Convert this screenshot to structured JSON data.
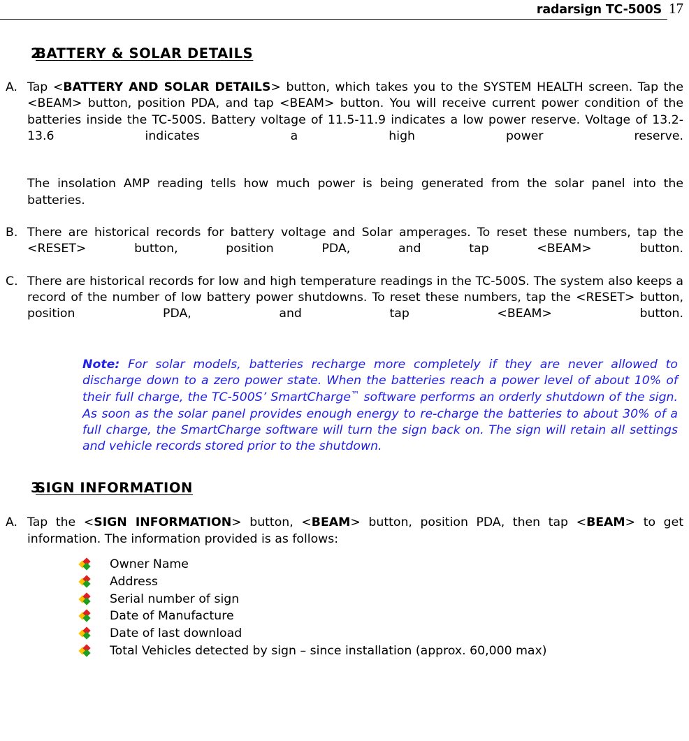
{
  "header": {
    "title": "radarsign TC-500S",
    "page_number": "17"
  },
  "sections": [
    {
      "number": "2.",
      "title": "BATTERY & SOLAR DETAILS",
      "items": [
        {
          "marker": "A.",
          "p1_pre": "Tap ",
          "p1_lt": "<",
          "p1_bold": "BATTERY AND SOLAR DETAILS",
          "p1_gt": ">",
          "p1_post": " button, which takes you to the SYSTEM HEALTH screen.  Tap the <BEAM> button, position PDA, and tap <BEAM> button.  You will receive current power condition of the batteries inside the TC-500S.  Battery voltage of 11.5-11.9 indicates a low power reserve.  Voltage of 13.2-13.6 indicates a high power reserve.",
          "p2": "The insolation AMP reading tells how much power is being generated from the solar panel into the batteries."
        },
        {
          "marker": "B.",
          "text": "There are historical records for battery voltage and Solar amperages.  To reset these numbers, tap the <RESET> button, position PDA, and tap <BEAM> button."
        },
        {
          "marker": "C.",
          "text": "There are historical records for low and high temperature readings in the TC-500S.  The system also keeps a record of the number of low battery power shutdowns.  To reset these numbers, tap the <RESET> button, position PDA, and tap <BEAM> button."
        }
      ],
      "note": {
        "label": "Note:",
        "text_part1": "  For solar models, batteries recharge more completely if they are never allowed to discharge down to a zero power state.  When the batteries reach a power level of about 10%  of their full charge, the TC-500S’ SmartCharge",
        "tm": "™",
        "text_part2": " software performs an orderly shutdown of the sign.   As soon as the solar panel provides enough energy to re-charge the batteries to about 30%  of a full charge, the SmartCharge software will turn the sign back on.  The sign will retain all settings and vehicle records stored prior to the shutdown.",
        "color": "#2222E6"
      }
    },
    {
      "number": "3.",
      "title": "SIGN INFORMATION",
      "items": [
        {
          "marker": "A.",
          "t1": "Tap the ",
          "t2_lt": "<",
          "t2_bold": "SIGN INFORMATION",
          "t2_gt": ">",
          "t3": " button, ",
          "t4_lt": "<",
          "t4_bold": "BEAM",
          "t4_gt": ">",
          "t5": " button, position PDA, then tap ",
          "t6_lt": "<",
          "t6_bold": "BEAM",
          "t6_gt": ">",
          "t7": " to get information.  The information provided is as follows:"
        }
      ],
      "bullets": [
        "Owner Name",
        "Address",
        "Serial number of sign",
        "Date of Manufacture",
        "Date of last download",
        "Total Vehicles detected by sign – since installation (approx. 60,000 max)"
      ],
      "bullet_icon": "colorful-diamond-bullet-icon",
      "bullet_colors": {
        "yellow": "#FFC000",
        "red": "#E02020",
        "green": "#1F9F1F"
      }
    }
  ]
}
